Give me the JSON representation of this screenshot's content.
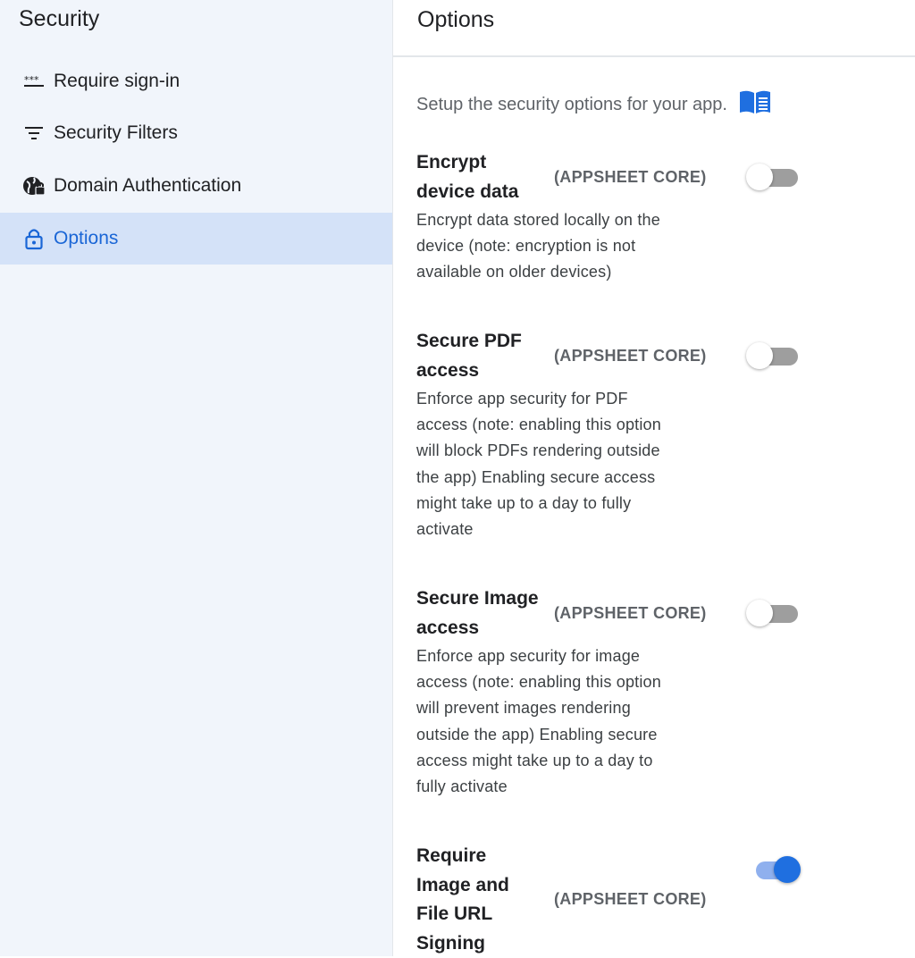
{
  "sidebar": {
    "title": "Security",
    "items": [
      {
        "label": "Require sign-in",
        "icon": "password-dots-icon",
        "active": false
      },
      {
        "label": "Security Filters",
        "icon": "filter-icon",
        "active": false
      },
      {
        "label": "Domain Authentication",
        "icon": "globe-lock-icon",
        "active": false
      },
      {
        "label": "Options",
        "icon": "lock-icon",
        "active": true
      }
    ]
  },
  "main": {
    "title": "Options",
    "intro": "Setup the security options for your app.",
    "intro_icon": "book-icon",
    "options": [
      {
        "title_lines": [
          "Encrypt",
          "device data"
        ],
        "tag": "(APPSHEET CORE)",
        "desc_lines": [
          "Encrypt data stored locally on the",
          "device (note: encryption is not",
          "available on older devices)"
        ],
        "enabled": false
      },
      {
        "title_lines": [
          "Secure PDF",
          "access"
        ],
        "tag": "(APPSHEET CORE)",
        "desc_lines": [
          "Enforce app security for PDF",
          "access (note: enabling this option",
          "will block PDFs rendering outside",
          "the app) Enabling secure access",
          "might take up to a day to fully",
          "activate"
        ],
        "enabled": false
      },
      {
        "title_lines": [
          "Secure Image",
          "access"
        ],
        "tag": "(APPSHEET CORE)",
        "desc_lines": [
          "Enforce app security for image",
          "access (note: enabling this option",
          "will prevent images rendering",
          "outside the app) Enabling secure",
          "access might take up to a day to",
          "fully activate"
        ],
        "enabled": false
      },
      {
        "title_lines": [
          "Require",
          "Image and",
          "File URL",
          "Signing"
        ],
        "tag": "(APPSHEET CORE)",
        "desc_lines": [],
        "enabled": true
      }
    ]
  },
  "colors": {
    "accent": "#1f6fe0",
    "active_bg": "#d4e2f8",
    "sidebar_bg": "#f1f5fb"
  }
}
